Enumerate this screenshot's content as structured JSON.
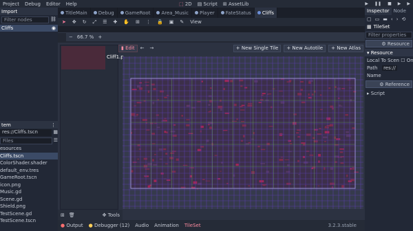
{
  "menu": {
    "items": [
      "Project",
      "Debug",
      "Editor",
      "Help"
    ]
  },
  "workspaces": {
    "items": [
      "2D",
      "Script",
      "AssetLib"
    ]
  },
  "tabs": [
    "TitleMain",
    "Debug",
    "GameRoot",
    "Area_Music",
    "Player",
    "FateStatus",
    "Cliffs"
  ],
  "left": {
    "scene_tab": "Import",
    "filter_placeholder": "Filter nodes",
    "selected_node": "Cliffs",
    "fs_header": "tem",
    "path_value": "res://Cliffs.tscn",
    "files_placeholder": "Files",
    "files": [
      "Cliffs.tscn",
      "ColorShader.shader",
      "default_env.tres",
      "GameRoot.tscn",
      "icon.png",
      "Music.gd",
      "Scene.gd",
      "Shield.png",
      "TestScene.gd",
      "TestScene.tscn"
    ],
    "resources_label": "esources"
  },
  "toolbar": {
    "view_label": "View"
  },
  "viewport": {
    "zoom": "66.7 %"
  },
  "tileset": {
    "edit_label": "Edit",
    "thumb_label": "Cliff1.p",
    "new_single": "New Single Tile",
    "new_auto": "New Autotile",
    "new_atlas": "New Atlas"
  },
  "leftbottom": {
    "tools_label": "Tools"
  },
  "bottom": {
    "items": [
      "Output",
      "Debugger (12)",
      "Audio",
      "Animation",
      "TileSet"
    ],
    "version": "3.2.3.stable"
  },
  "inspector": {
    "tab_inspector": "Inspector",
    "tab_node": "Node",
    "object": "TileSet",
    "filter_placeholder": "Filter properties",
    "resource_btn": "Resource",
    "resource_section": "Resource",
    "local_to_scene": "Local To Scen",
    "local_value": "On",
    "path_label": "Path",
    "path_value": "res://",
    "name_label": "Name",
    "reference_btn": "Reference",
    "script_label": "Script"
  },
  "colors": {
    "accent": "#ff8ca0",
    "grid": "#5b3fae",
    "region": "#9b8cd8"
  }
}
